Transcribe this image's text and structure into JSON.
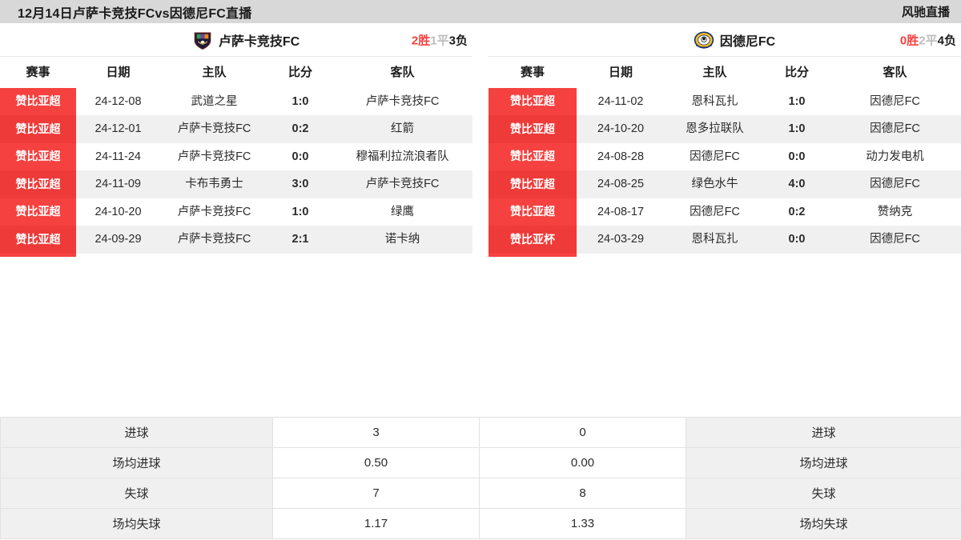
{
  "topbar": {
    "title": "12月14日卢萨卡竞技FCvs因德尼FC直播",
    "brand": "风驰直播"
  },
  "colors": {
    "accent_red": "#f5413f",
    "header_gray": "#d8d8d8",
    "row_alt": "#f0f0f0",
    "draw_gray": "#bdbdbd"
  },
  "left_panel": {
    "team": {
      "name": "卢萨卡竞技FC",
      "crest": "lusaka-crest-icon",
      "record": {
        "wins": "2",
        "wins_label": "胜",
        "draws": "1",
        "draws_label": "平",
        "losses": "3",
        "losses_label": "负"
      }
    },
    "columns": [
      "赛事",
      "日期",
      "主队",
      "比分",
      "客队"
    ],
    "rows": [
      {
        "league": "赞比亚超",
        "date": "24-12-08",
        "home": "武道之星",
        "score": "1:0",
        "away": "卢萨卡竞技FC"
      },
      {
        "league": "赞比亚超",
        "date": "24-12-01",
        "home": "卢萨卡竞技FC",
        "score": "0:2",
        "away": "红箭"
      },
      {
        "league": "赞比亚超",
        "date": "24-11-24",
        "home": "卢萨卡竞技FC",
        "score": "0:0",
        "away": "穆福利拉流浪者队"
      },
      {
        "league": "赞比亚超",
        "date": "24-11-09",
        "home": "卡布韦勇士",
        "score": "3:0",
        "away": "卢萨卡竞技FC"
      },
      {
        "league": "赞比亚超",
        "date": "24-10-20",
        "home": "卢萨卡竞技FC",
        "score": "1:0",
        "away": "绿鹰"
      },
      {
        "league": "赞比亚超",
        "date": "24-09-29",
        "home": "卢萨卡竞技FC",
        "score": "2:1",
        "away": "诺卡纳"
      }
    ]
  },
  "right_panel": {
    "team": {
      "name": "因德尼FC",
      "crest": "indeni-crest-icon",
      "record": {
        "wins": "0",
        "wins_label": "胜",
        "draws": "2",
        "draws_label": "平",
        "losses": "4",
        "losses_label": "负"
      }
    },
    "columns": [
      "赛事",
      "日期",
      "主队",
      "比分",
      "客队"
    ],
    "rows": [
      {
        "league": "赞比亚超",
        "date": "24-11-02",
        "home": "恩科瓦扎",
        "score": "1:0",
        "away": "因德尼FC"
      },
      {
        "league": "赞比亚超",
        "date": "24-10-20",
        "home": "恩多拉联队",
        "score": "1:0",
        "away": "因德尼FC"
      },
      {
        "league": "赞比亚超",
        "date": "24-08-28",
        "home": "因德尼FC",
        "score": "0:0",
        "away": "动力发电机"
      },
      {
        "league": "赞比亚超",
        "date": "24-08-25",
        "home": "绿色水牛",
        "score": "4:0",
        "away": "因德尼FC"
      },
      {
        "league": "赞比亚超",
        "date": "24-08-17",
        "home": "因德尼FC",
        "score": "0:2",
        "away": "赞纳克"
      },
      {
        "league": "赞比亚杯",
        "date": "24-03-29",
        "home": "恩科瓦扎",
        "score": "0:0",
        "away": "因德尼FC"
      }
    ]
  },
  "stats": [
    {
      "left_label": "进球",
      "left_value": "3",
      "right_value": "0",
      "right_label": "进球"
    },
    {
      "left_label": "场均进球",
      "left_value": "0.50",
      "right_value": "0.00",
      "right_label": "场均进球"
    },
    {
      "left_label": "失球",
      "left_value": "7",
      "right_value": "8",
      "right_label": "失球"
    },
    {
      "left_label": "场均失球",
      "left_value": "1.17",
      "right_value": "1.33",
      "right_label": "场均失球"
    }
  ]
}
